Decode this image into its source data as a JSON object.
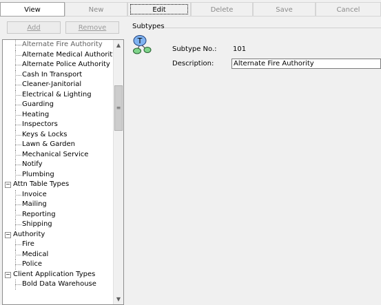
{
  "toolbar": {
    "view": "View",
    "new": "New",
    "edit": "Edit",
    "delete": "Delete",
    "save": "Save",
    "cancel": "Cancel"
  },
  "left_buttons": {
    "add": "Add",
    "remove": "Remove"
  },
  "tree": {
    "items": [
      {
        "label": "Alternate Fire Authority",
        "level": 1
      },
      {
        "label": "Alternate Medical Authority",
        "level": 1
      },
      {
        "label": "Alternate Police Authority",
        "level": 1
      },
      {
        "label": "Cash In Transport",
        "level": 1
      },
      {
        "label": "Cleaner-Janitorial",
        "level": 1
      },
      {
        "label": "Electrical & Lighting",
        "level": 1
      },
      {
        "label": "Guarding",
        "level": 1
      },
      {
        "label": "Heating",
        "level": 1
      },
      {
        "label": "Inspectors",
        "level": 1
      },
      {
        "label": "Keys & Locks",
        "level": 1
      },
      {
        "label": "Lawn & Garden",
        "level": 1
      },
      {
        "label": "Mechanical Service",
        "level": 1
      },
      {
        "label": "Notify",
        "level": 1
      },
      {
        "label": "Plumbing",
        "level": 1
      },
      {
        "label": "Attn Table Types",
        "level": 0,
        "expander": "−"
      },
      {
        "label": "Invoice",
        "level": 1
      },
      {
        "label": "Mailing",
        "level": 1
      },
      {
        "label": "Reporting",
        "level": 1
      },
      {
        "label": "Shipping",
        "level": 1
      },
      {
        "label": "Authority",
        "level": 0,
        "expander": "−"
      },
      {
        "label": "Fire",
        "level": 1
      },
      {
        "label": "Medical",
        "level": 1
      },
      {
        "label": "Police",
        "level": 1
      },
      {
        "label": "Client Application Types",
        "level": 0,
        "expander": "−"
      },
      {
        "label": "Bold Data Warehouse",
        "level": 1
      }
    ],
    "scroll_up_icon": "▲",
    "scroll_down_icon": "▼",
    "scroll_grip_icon": "≡"
  },
  "details": {
    "group_title": "Subtypes",
    "subtype_no_label": "Subtype No.:",
    "subtype_no_value": "101",
    "description_label": "Description:",
    "description_value": "Alternate Fire Authority",
    "icon_letter": "T"
  },
  "colors": {
    "icon_blue": "#7fb2f0",
    "icon_green": "#7fd48a"
  }
}
